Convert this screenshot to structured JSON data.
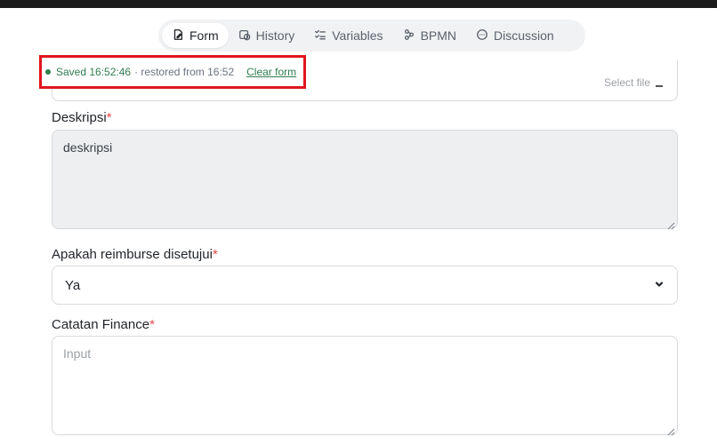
{
  "tabs": [
    {
      "label": "Form",
      "icon": "form-edit-icon",
      "active": true
    },
    {
      "label": "History",
      "icon": "history-icon",
      "active": false
    },
    {
      "label": "Variables",
      "icon": "list-check-icon",
      "active": false
    },
    {
      "label": "BPMN",
      "icon": "workflow-icon",
      "active": false
    },
    {
      "label": "Discussion",
      "icon": "chat-bubble-icon",
      "active": false
    }
  ],
  "save_status": {
    "saved_text": "Saved 16:52:46",
    "restored_text": "· restored from 16:52",
    "clear_label": "Clear form"
  },
  "previous_field": {
    "partial_text": "Select file"
  },
  "fields": {
    "deskripsi": {
      "label": "Deskripsi",
      "required_mark": "*",
      "value": "deskripsi"
    },
    "apakah_reimburse": {
      "label": "Apakah reimburse disetujui",
      "required_mark": "*",
      "selected": "Ya"
    },
    "catatan_finance": {
      "label": "Catatan Finance",
      "required_mark": "*",
      "placeholder": "Input",
      "value": ""
    }
  },
  "colors": {
    "highlight_border": "#e0151e",
    "saved_green": "#2e7d4f",
    "required_red": "#e5484d"
  }
}
